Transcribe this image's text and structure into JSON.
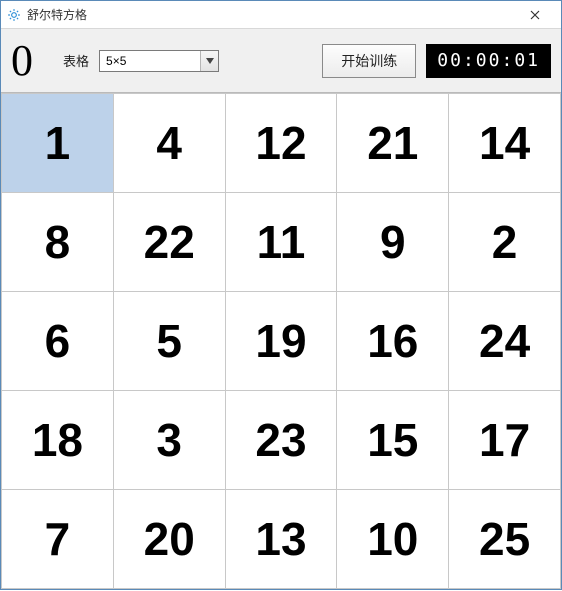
{
  "window": {
    "title": "舒尔特方格"
  },
  "toolbar": {
    "counter": "0",
    "grid_label": "表格",
    "grid_select_value": "5×5",
    "start_button": "开始训练",
    "timer": "00:00:01"
  },
  "grid": {
    "size": 5,
    "selected_index": 0,
    "cells": [
      [
        1,
        4,
        12,
        21,
        14
      ],
      [
        8,
        22,
        11,
        9,
        2
      ],
      [
        6,
        5,
        19,
        16,
        24
      ],
      [
        18,
        3,
        23,
        15,
        17
      ],
      [
        7,
        20,
        13,
        10,
        25
      ]
    ]
  }
}
